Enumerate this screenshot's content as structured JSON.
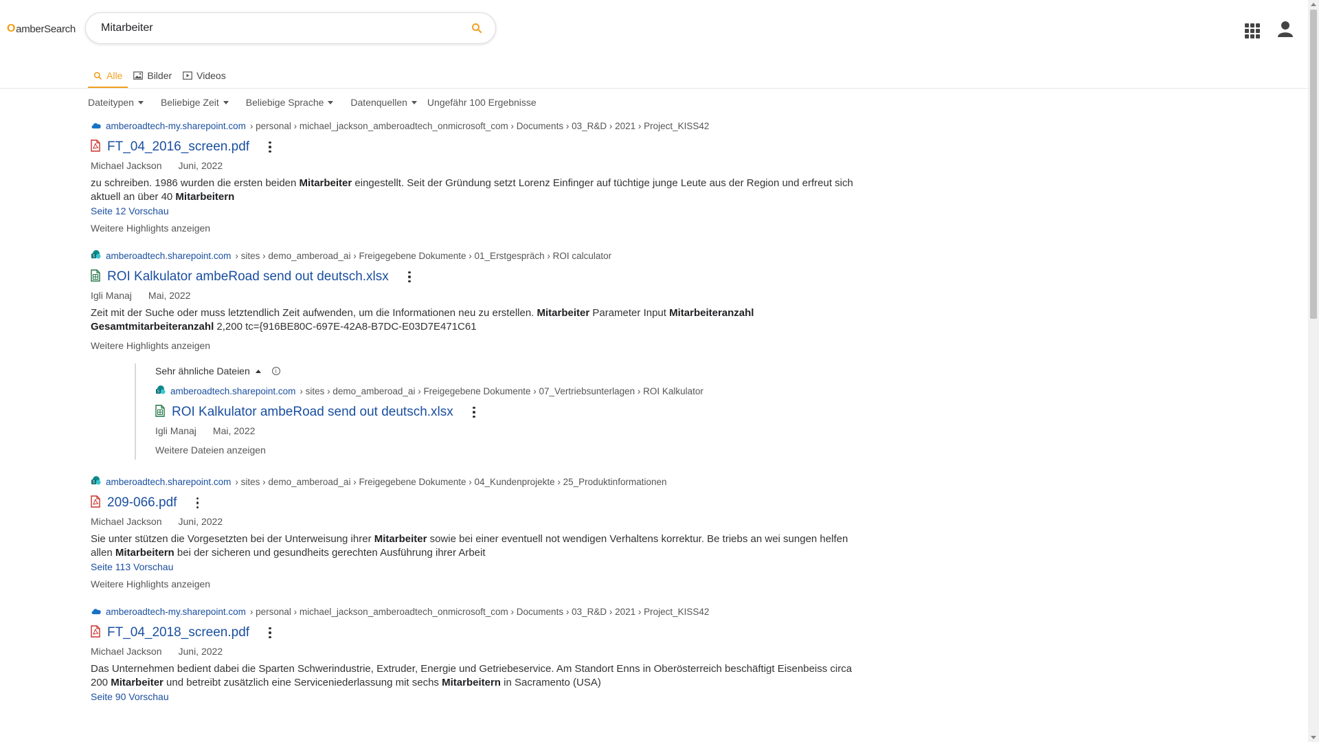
{
  "app": {
    "logo_mark": "O",
    "logo_text": "amberSearch"
  },
  "search": {
    "query": "Mitarbeiter",
    "placeholder": ""
  },
  "tabs": [
    {
      "label": "Alle",
      "icon": "search-icon",
      "active": true
    },
    {
      "label": "Bilder",
      "icon": "image-icon",
      "active": false
    },
    {
      "label": "Videos",
      "icon": "video-icon",
      "active": false
    }
  ],
  "filters": [
    {
      "label": "Dateitypen"
    },
    {
      "label": "Beliebige Zeit"
    },
    {
      "label": "Beliebige Sprache"
    },
    {
      "label": "Datenquellen"
    }
  ],
  "result_count": "Ungefähr 100 Ergebnisse",
  "colors": {
    "accent": "#f0a020",
    "link": "#1a4fa0"
  },
  "results": [
    {
      "source_icon": "onedrive-icon",
      "domain": "amberoadtech-my.sharepoint.com",
      "path": "› personal › michael_jackson_amberoadtech_onmicrosoft_com › Documents › 03_R&D › 2021 › Project_KISS42",
      "file_icon": "pdf-file-icon",
      "title": "FT_04_2016_screen.pdf",
      "author": "Michael Jackson",
      "date": "Juni, 2022",
      "snippet_html": "zu schreiben. 1986 wurden die ersten beiden <b>Mitarbeiter</b> eingestellt. Seit der Gründung setzt Lorenz Einfinger auf tüchtige junge Leute aus der Region und erfreut sich aktuell an über 40 <b>Mitarbeitern</b>",
      "preview": "Seite 12 Vorschau",
      "more": "Weitere Highlights anzeigen"
    },
    {
      "source_icon": "sharepoint-icon",
      "domain": "amberoadtech.sharepoint.com",
      "path": "› sites › demo_amberoad_ai › Freigegebene Dokumente › 01_Erstgespräch › ROI calculator",
      "file_icon": "excel-file-icon",
      "title": "ROI Kalkulator ambeRoad send out deutsch.xlsx",
      "author": "Igli Manaj",
      "date": "Mai, 2022",
      "snippet_html": "Zeit mit der Suche oder muss letztendlich Zeit aufwenden, um die Informationen neu zu erstellen. <b>Mitarbeiter</b> Parameter Input <b>Mitarbeiteranzahl Gesamtmitarbeiteranzahl</b> 2,200 tc={916BE80C-697E-42A8-B7DC-E03D7E471C61",
      "preview": "",
      "more": "Weitere Highlights anzeigen",
      "similar": {
        "label": "Sehr ähnliche Dateien",
        "info_glyph": "i",
        "item": {
          "source_icon": "sharepoint-icon",
          "domain": "amberoadtech.sharepoint.com",
          "path": "› sites › demo_amberoad_ai › Freigegebene Dokumente › 07_Vertriebsunterlagen › ROI Kalkulator",
          "file_icon": "excel-file-icon",
          "title": "ROI Kalkulator ambeRoad send out deutsch.xlsx",
          "author": "Igli Manaj",
          "date": "Mai, 2022"
        },
        "more": "Weitere Dateien anzeigen"
      }
    },
    {
      "source_icon": "sharepoint-icon",
      "domain": "amberoadtech.sharepoint.com",
      "path": "› sites › demo_amberoad_ai › Freigegebene Dokumente › 04_Kundenprojekte › 25_Produktinformationen",
      "file_icon": "pdf-file-icon",
      "title": "209-066.pdf",
      "author": "Michael Jackson",
      "date": "Juni, 2022",
      "snippet_html": "Sie unter stützen die Vorgesetzten bei der Unterweisung ihrer <b>Mitarbeiter</b> sowie bei einer eventuell not wendigen Verhaltens korrektur. Be triebs an wei sungen helfen allen <b>Mitarbeitern</b> bei der sicheren und gesundheits gerechten Ausführung ihrer Arbeit",
      "preview": "Seite 113 Vorschau",
      "more": "Weitere Highlights anzeigen"
    },
    {
      "source_icon": "onedrive-icon",
      "domain": "amberoadtech-my.sharepoint.com",
      "path": "› personal › michael_jackson_amberoadtech_onmicrosoft_com › Documents › 03_R&D › 2021 › Project_KISS42",
      "file_icon": "pdf-file-icon",
      "title": "FT_04_2018_screen.pdf",
      "author": "Michael Jackson",
      "date": "Juni, 2022",
      "snippet_html": "Das Unternehmen bedient dabei die Sparten Schwerindustrie, Extruder, Energie und Getriebeservice. Am Standort Enns in Oberösterreich beschäftigt Eisenbeiss circa 200 <b>Mitarbeiter</b> und betreibt zusätzlich eine Serviceniederlassung mit sechs <b>Mitarbeitern</b> in Sacramento (USA)",
      "preview": "Seite 90 Vorschau",
      "more": ""
    }
  ]
}
